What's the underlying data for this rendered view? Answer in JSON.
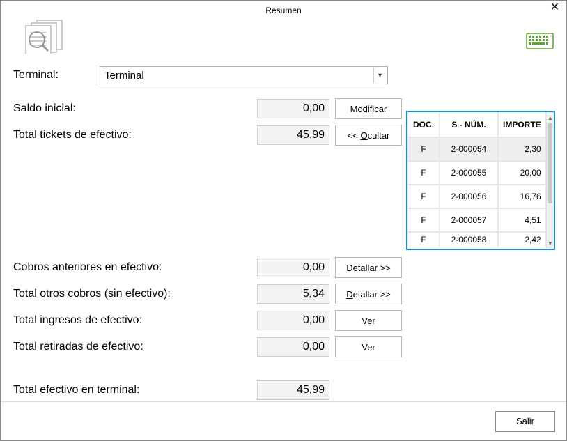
{
  "window": {
    "title": "Resumen"
  },
  "terminal": {
    "label": "Terminal:",
    "value": "Terminal"
  },
  "rows": {
    "saldo_inicial": {
      "label": "Saldo inicial:",
      "value": "0,00",
      "button": "Modificar"
    },
    "total_tickets": {
      "label": "Total tickets de efectivo:",
      "value": "45,99",
      "button_prefix": "<< ",
      "button_mid_u": "O",
      "button_rest": "cultar"
    },
    "cobros_anteriores": {
      "label": "Cobros anteriores en efectivo:",
      "value": "0,00",
      "button_u": "D",
      "button_rest": "etallar >>"
    },
    "total_otros": {
      "label": "Total otros cobros (sin efectivo):",
      "value": "5,34",
      "button_u": "D",
      "button_rest": "etallar >>"
    },
    "total_ingresos": {
      "label": "Total ingresos de efectivo:",
      "value": "0,00",
      "button": "Ver"
    },
    "total_retiradas": {
      "label": "Total retiradas de efectivo:",
      "value": "0,00",
      "button": "Ver"
    },
    "total_efectivo": {
      "label": "Total efectivo en terminal:",
      "value": "45,99"
    }
  },
  "detail": {
    "headers": {
      "doc": "DOC.",
      "snum": "S - NÚM.",
      "importe": "IMPORTE"
    },
    "rows": [
      {
        "doc": "F",
        "snum": "2-000054",
        "importe": "2,30"
      },
      {
        "doc": "F",
        "snum": "2-000055",
        "importe": "20,00"
      },
      {
        "doc": "F",
        "snum": "2-000056",
        "importe": "16,76"
      },
      {
        "doc": "F",
        "snum": "2-000057",
        "importe": "4,51"
      },
      {
        "doc": "F",
        "snum": "2-000058",
        "importe": "2,42"
      }
    ]
  },
  "footer": {
    "exit": "Salir"
  }
}
